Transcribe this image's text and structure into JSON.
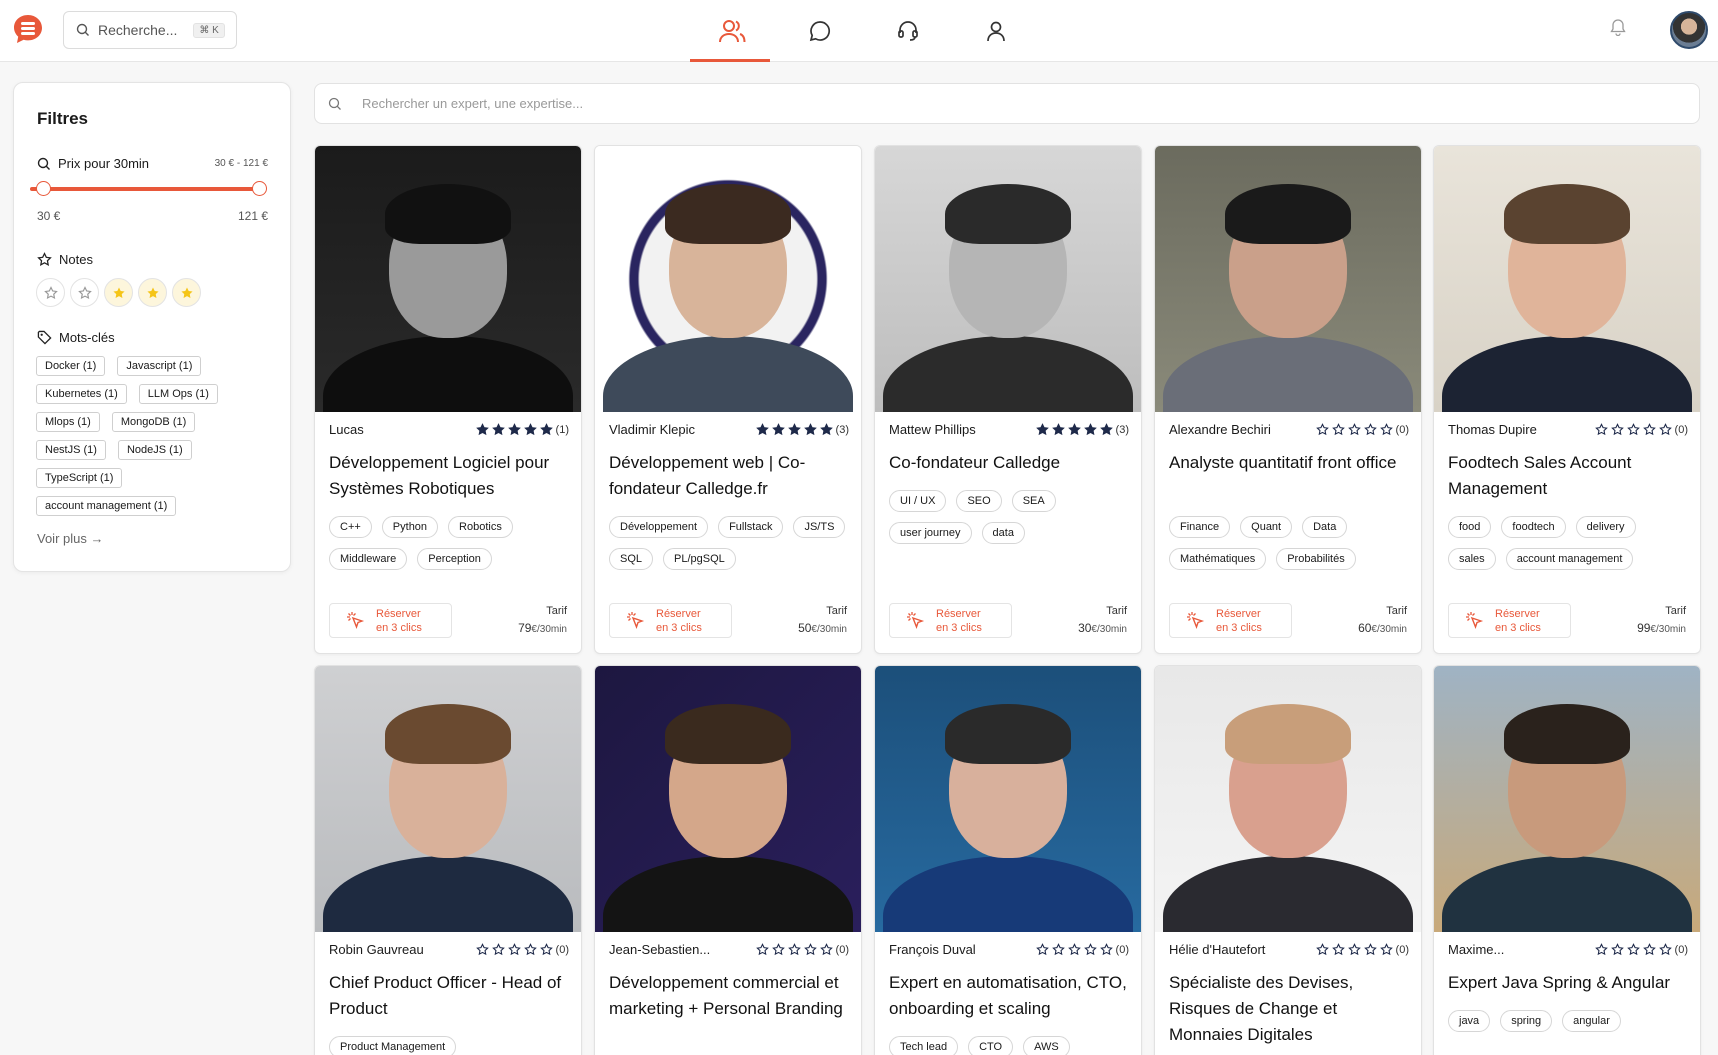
{
  "header": {
    "search_placeholder": "Recherche...",
    "shortcut": "⌘ K",
    "nav": [
      "experts-icon",
      "chat-icon",
      "support-icon",
      "profile-icon"
    ]
  },
  "filters": {
    "title": "Filtres",
    "price_label": "Prix pour 30min",
    "price_range": "30 € - 121 €",
    "price_min": "30 €",
    "price_max": "121 €",
    "notes_label": "Notes",
    "keywords_label": "Mots-clés",
    "keywords": [
      "Docker (1)",
      "Javascript (1)",
      "Kubernetes (1)",
      "LLM Ops (1)",
      "Mlops (1)",
      "MongoDB (1)",
      "NestJS (1)",
      "NodeJS (1)",
      "TypeScript (1)",
      "account management (1)"
    ],
    "see_more": "Voir plus →"
  },
  "main": {
    "search_placeholder": "Rechercher un expert, une expertise..."
  },
  "colors": {
    "accent": "#e8583a",
    "star": "#1f2a4a"
  },
  "cards": [
    {
      "name": "Lucas",
      "stars": 5,
      "count": "(1)",
      "title": "Développement Logiciel pour Systèmes Robotiques",
      "tags": [
        "C++",
        "Python",
        "Robotics",
        "Middleware",
        "Perception"
      ],
      "reserve": "Réserver",
      "reserve2": "en 3 clics",
      "tarif": "Tarif",
      "price": "79",
      "unit": "€/30min"
    },
    {
      "name": "Vladimir Klepic",
      "stars": 5,
      "count": "(3)",
      "title": "Développement web | Co-fondateur Calledge.fr",
      "tags": [
        "Développement",
        "Fullstack",
        "JS/TS",
        "SQL",
        "PL/pgSQL"
      ],
      "reserve": "Réserver",
      "reserve2": "en 3 clics",
      "tarif": "Tarif",
      "price": "50",
      "unit": "€/30min"
    },
    {
      "name": "Mattew Phillips",
      "stars": 5,
      "count": "(3)",
      "title": "Co-fondateur Calledge",
      "tags": [
        "UI / UX",
        "SEO",
        "SEA",
        "user journey",
        "data"
      ],
      "reserve": "Réserver",
      "reserve2": "en 3 clics",
      "tarif": "Tarif",
      "price": "30",
      "unit": "€/30min"
    },
    {
      "name": "Alexandre Bechiri",
      "stars": 0,
      "count": "(0)",
      "title": "Analyste quantitatif front office",
      "tags": [
        "Finance",
        "Quant",
        "Data",
        "Mathématiques",
        "Probabilités"
      ],
      "reserve": "Réserver",
      "reserve2": "en 3 clics",
      "tarif": "Tarif",
      "price": "60",
      "unit": "€/30min"
    },
    {
      "name": "Thomas Dupire",
      "stars": 0,
      "count": "(0)",
      "title": "Foodtech Sales Account Management",
      "tags": [
        "food",
        "foodtech",
        "delivery",
        "sales",
        "account management"
      ],
      "reserve": "Réserver",
      "reserve2": "en 3 clics",
      "tarif": "Tarif",
      "price": "99",
      "unit": "€/30min"
    },
    {
      "name": "Robin Gauvreau",
      "stars": 0,
      "count": "(0)",
      "title": "Chief Product Officer - Head of Product",
      "tags": [
        "Product Management"
      ]
    },
    {
      "name": "Jean-Sebastien...",
      "stars": 0,
      "count": "(0)",
      "title": "Développement commercial et marketing + Personal Branding",
      "tags": []
    },
    {
      "name": "François Duval",
      "stars": 0,
      "count": "(0)",
      "title": "Expert en automatisation, CTO, onboarding et scaling",
      "tags": [
        "Tech lead",
        "CTO",
        "AWS"
      ]
    },
    {
      "name": "Hélie d'Hautefort",
      "stars": 0,
      "count": "(0)",
      "title": "Spécialiste des Devises, Risques de Change et Monnaies Digitales",
      "tags": []
    },
    {
      "name": "Maxime...",
      "stars": 0,
      "count": "(0)",
      "title": "Expert Java Spring & Angular",
      "tags": [
        "java",
        "spring",
        "angular"
      ]
    }
  ]
}
